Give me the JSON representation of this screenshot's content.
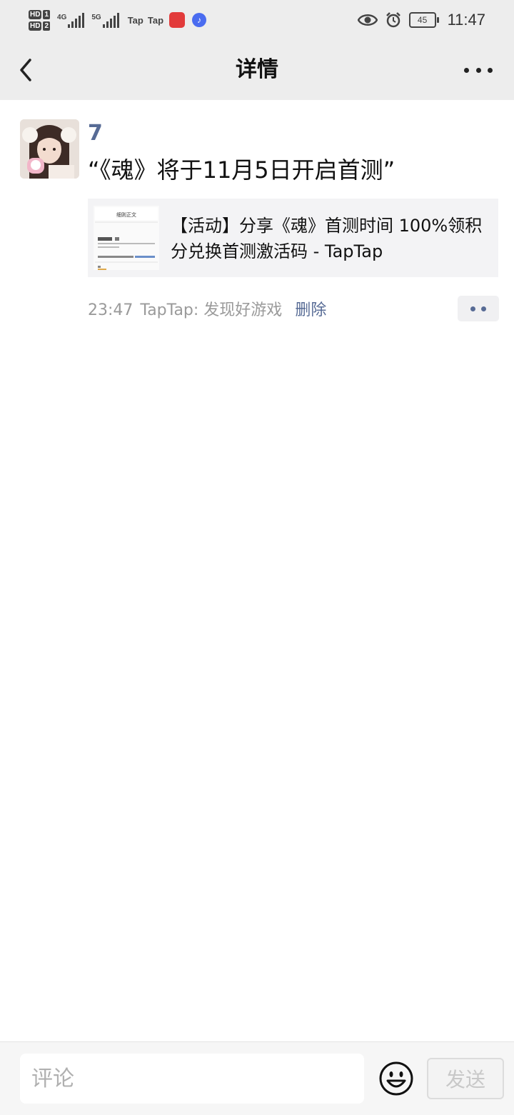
{
  "status_bar": {
    "sim1_label": "HD",
    "sim1_num": "1",
    "sim2_label": "HD",
    "sim2_num": "2",
    "net1": "4G",
    "net2": "5G",
    "app_label_1": "Tap",
    "app_label_2": "Tap",
    "battery": "45",
    "time": "11:47",
    "icons": [
      "eye-icon",
      "alarm-icon",
      "battery-icon",
      "music-icon"
    ]
  },
  "header": {
    "title": "详情",
    "back_icon": "chevron-left-icon",
    "more_icon": "more-dots-icon"
  },
  "post": {
    "username": "7",
    "text": "“《魂》将于11月5日开启首测”",
    "link_card": {
      "title": "【活动】分享《魂》首测时间 100%领积分兑换首测激活码 - TapTap",
      "thumb_heading": "细则正文"
    },
    "time": "23:47",
    "source": "TapTap: 发现好游戏",
    "delete_label": "删除",
    "action_icon": "comment-dots-icon"
  },
  "comment_bar": {
    "placeholder": "评论",
    "emoji_icon": "smiley-icon",
    "send_label": "发送"
  },
  "colors": {
    "bar_bg": "#ededed",
    "link_blue": "#576b95",
    "card_bg": "#f3f3f5"
  }
}
